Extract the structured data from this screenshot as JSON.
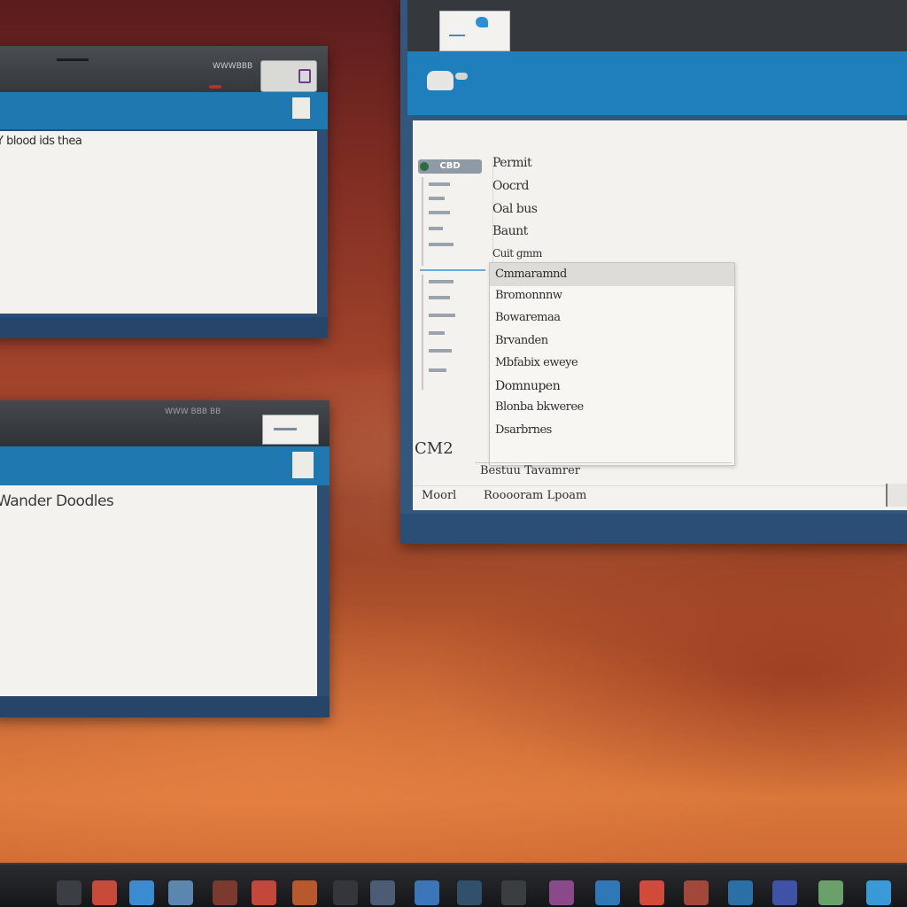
{
  "windows": {
    "top_left": {
      "title_caption": "WWWBBB",
      "content_heading": "Y blood ids thea"
    },
    "bottom_left": {
      "title_caption": "WWW BBB BB",
      "content_heading": "Wander Doodles"
    },
    "right": {
      "sidebar_badge": "CBD",
      "sidebar_footer": "CM2",
      "menu_items": [
        "Permit",
        "Oocrd",
        "Oal bus",
        "Baunt",
        "Cuit gmm"
      ],
      "dropdown_items": [
        "Cmmaramnd",
        "Bromonnnw",
        "Bowaremaa",
        "Brvanden",
        "Mbfabix eweye",
        "Domnupen",
        "Blonba bkweree",
        "Dsarbrnes"
      ],
      "status": {
        "top_label": "Bestuu Tavamrer",
        "left_label": "Moorl",
        "right_label": "Rooooram Lpoam"
      }
    }
  },
  "taskbar": {
    "icons": [
      "finder-icon",
      "app-icon",
      "safari-icon",
      "mail-icon",
      "music-icon",
      "photos-icon",
      "calendar-icon",
      "notes-icon",
      "terminal-icon",
      "preview-icon",
      "settings-icon",
      "globe-icon",
      "store-icon",
      "maps-icon",
      "chrome-icon",
      "camera-icon",
      "network-icon",
      "disc-icon",
      "launch-icon",
      "trash-icon"
    ]
  },
  "colors": {
    "accent_blue": "#1f7fbc",
    "frame_blue": "#2d4d73",
    "content_bg": "#f3f2ef"
  }
}
